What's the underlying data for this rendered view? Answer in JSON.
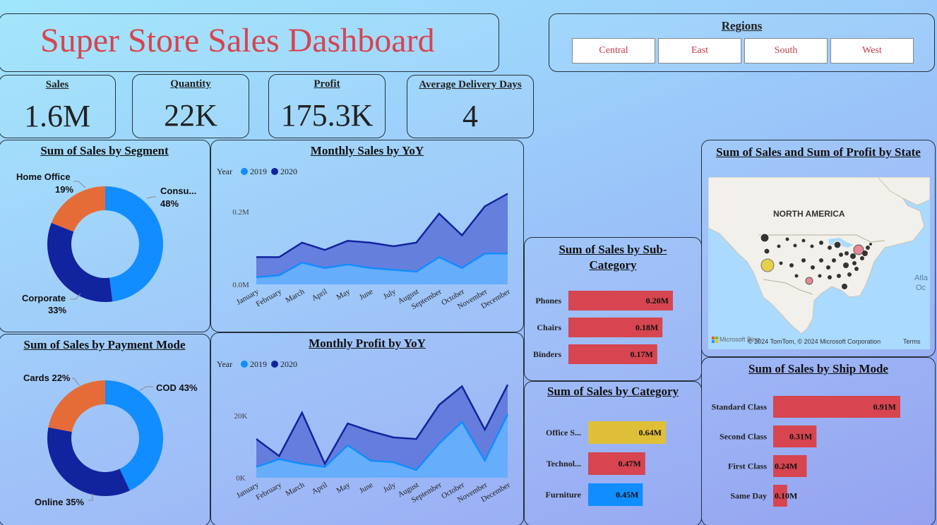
{
  "header": {
    "title": "Super Store Sales Dashboard"
  },
  "regions": {
    "title": "Regions",
    "items": [
      "Central",
      "East",
      "South",
      "West"
    ]
  },
  "kpis": {
    "sales": {
      "label": "Sales",
      "value": "1.6M"
    },
    "quantity": {
      "label": "Quantity",
      "value": "22K"
    },
    "profit": {
      "label": "Profit",
      "value": "175.3K"
    },
    "delivery": {
      "label": "Average Delivery Days",
      "value": "4"
    }
  },
  "colors": {
    "blue": "#118dff",
    "navy": "#12239e",
    "orange": "#e66c37",
    "red": "#d64550",
    "yellow": "#e0bf38",
    "area_dark": "#5a72d8",
    "area_light": "#66b2ff"
  },
  "map": {
    "title": "Sum of Sales and Sum of Profit by State",
    "label": "NORTH AMERICA",
    "atlantic": "Atla\nOc",
    "attribution": "© 2024 TomTom, © 2024 Microsoft Corporation",
    "terms": "Terms",
    "brand": "Microsoft Bing"
  },
  "chart_data": [
    {
      "id": "segment",
      "type": "pie",
      "title": "Sum of Sales by Segment",
      "slices": [
        {
          "label": "Consu...",
          "percent": 48,
          "display": "48%",
          "color": "#118dff"
        },
        {
          "label": "Corporate",
          "percent": 33,
          "display": "33%",
          "color": "#12239e"
        },
        {
          "label": "Home Office",
          "percent": 19,
          "display": "19%",
          "color": "#e66c37"
        }
      ]
    },
    {
      "id": "payment",
      "type": "pie",
      "title": "Sum of Sales by Payment Mode",
      "slices": [
        {
          "label": "COD",
          "percent": 43,
          "display": "COD 43%",
          "color": "#118dff"
        },
        {
          "label": "Online",
          "percent": 35,
          "display": "Online 35%",
          "color": "#12239e"
        },
        {
          "label": "Cards",
          "percent": 22,
          "display": "Cards 22%",
          "color": "#e66c37"
        }
      ]
    },
    {
      "id": "monthly_sales",
      "type": "area",
      "title": "Monthly Sales by YoY",
      "legend_title": "Year",
      "categories": [
        "January",
        "February",
        "March",
        "April",
        "May",
        "June",
        "July",
        "August",
        "September",
        "October",
        "November",
        "December"
      ],
      "series": [
        {
          "name": "2019",
          "values": [
            0.02,
            0.025,
            0.06,
            0.045,
            0.055,
            0.045,
            0.04,
            0.035,
            0.075,
            0.045,
            0.085,
            0.085
          ]
        },
        {
          "name": "2020",
          "values": [
            0.075,
            0.075,
            0.115,
            0.095,
            0.12,
            0.115,
            0.105,
            0.115,
            0.195,
            0.135,
            0.215,
            0.25
          ]
        }
      ],
      "yticks": [
        "0.0M",
        "0.2M"
      ],
      "ytick_values": [
        0,
        0.2
      ],
      "ylim": [
        0,
        0.28
      ]
    },
    {
      "id": "monthly_profit",
      "type": "area",
      "title": "Monthly Profit by YoY",
      "legend_title": "Year",
      "categories": [
        "January",
        "February",
        "March",
        "April",
        "May",
        "June",
        "July",
        "August",
        "September",
        "October",
        "November",
        "December"
      ],
      "series": [
        {
          "name": "2019",
          "values": [
            3500,
            6000,
            4500,
            3500,
            10500,
            5500,
            5000,
            2500,
            11000,
            18000,
            5500,
            20500
          ]
        },
        {
          "name": "2020",
          "values": [
            12500,
            7000,
            21000,
            4500,
            17500,
            15000,
            13000,
            12500,
            23500,
            29500,
            15500,
            30000
          ]
        }
      ],
      "yticks": [
        "0K",
        "20K"
      ],
      "ytick_values": [
        0,
        20000
      ],
      "ylim": [
        0,
        33000
      ]
    },
    {
      "id": "subcategory",
      "type": "bar",
      "orientation": "horizontal",
      "title": "Sum of Sales by Sub-Category",
      "categories": [
        "Phones",
        "Chairs",
        "Binders"
      ],
      "values": [
        0.2,
        0.18,
        0.17
      ],
      "labels": [
        "0.20M",
        "0.18M",
        "0.17M"
      ],
      "colors": [
        "#d64550",
        "#d64550",
        "#d64550"
      ],
      "xmax": 0.2
    },
    {
      "id": "category",
      "type": "bar",
      "orientation": "horizontal",
      "title": "Sum of Sales by Category",
      "categories": [
        "Office S...",
        "Technol...",
        "Furniture"
      ],
      "values": [
        0.64,
        0.47,
        0.45
      ],
      "labels": [
        "0.64M",
        "0.47M",
        "0.45M"
      ],
      "colors": [
        "#e0bf38",
        "#d64550",
        "#118dff"
      ],
      "xmax": 0.64
    },
    {
      "id": "shipmode",
      "type": "bar",
      "orientation": "horizontal",
      "title": "Sum of Sales by Ship Mode",
      "categories": [
        "Standard Class",
        "Second Class",
        "First Class",
        "Same Day"
      ],
      "values": [
        0.91,
        0.31,
        0.24,
        0.1
      ],
      "labels": [
        "0.91M",
        "0.31M",
        "0.24M",
        "0.10M"
      ],
      "colors": [
        "#d64550",
        "#d64550",
        "#d64550",
        "#d64550"
      ],
      "xmax": 0.91
    }
  ]
}
